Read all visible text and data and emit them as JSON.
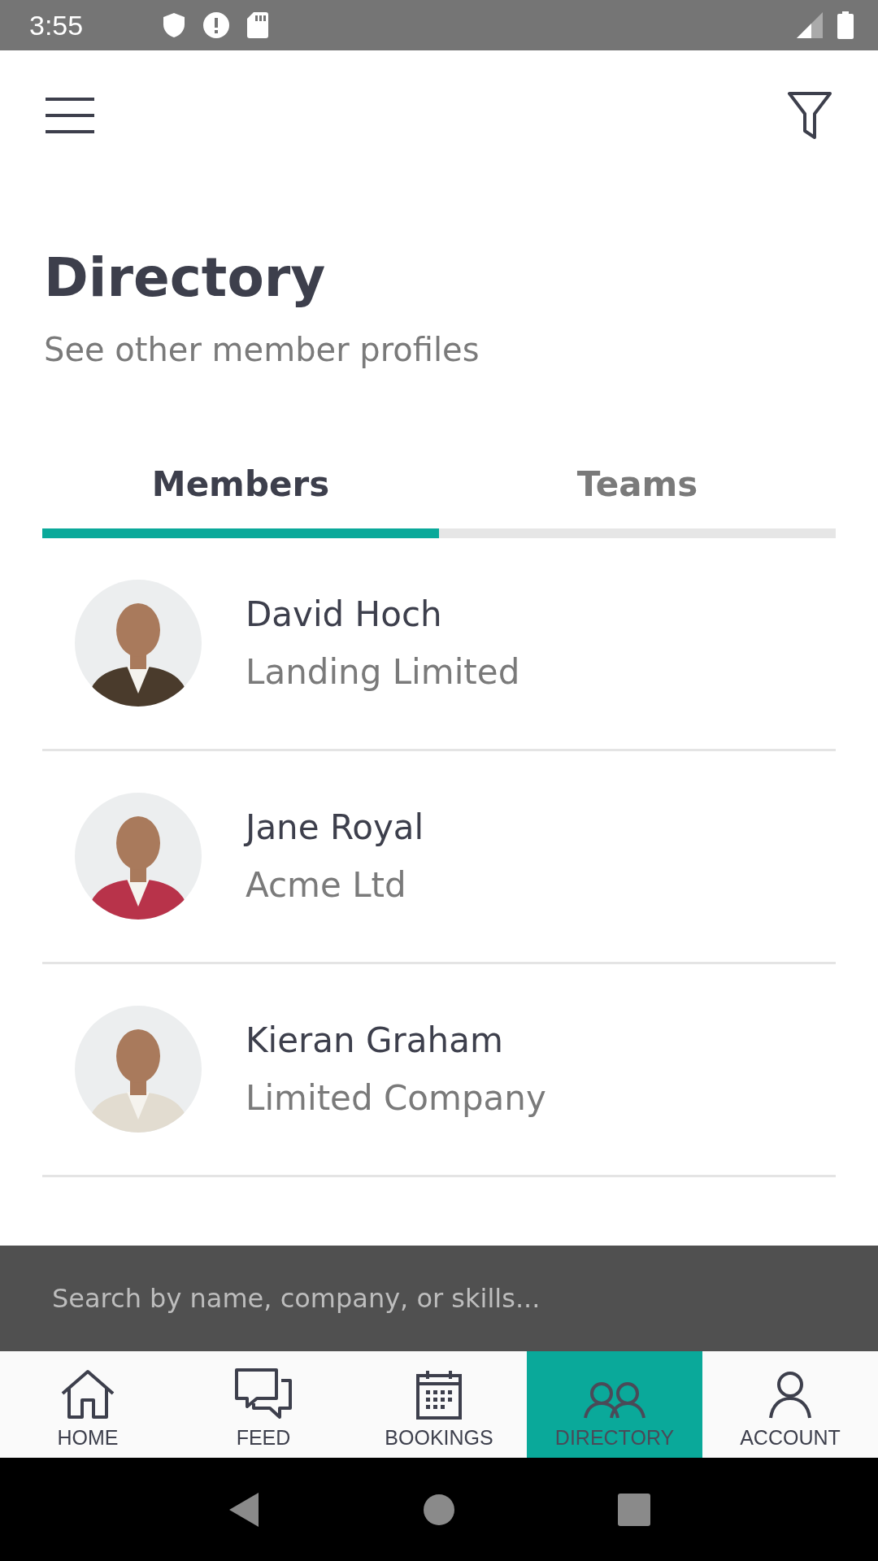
{
  "status_bar": {
    "time": "3:55"
  },
  "header": {
    "title": "Directory",
    "subtitle": "See other member profiles"
  },
  "tabs": [
    {
      "label": "Members",
      "selected": true
    },
    {
      "label": "Teams",
      "selected": false
    }
  ],
  "members": [
    {
      "name": "David Hoch",
      "company": "Landing Limited",
      "kind": "picture"
    },
    {
      "name": "Jane Royal",
      "company": "Acme Ltd",
      "kind": "picture"
    },
    {
      "name": "Kieran Graham",
      "company": "Limited Company",
      "kind": "picture"
    }
  ],
  "search": {
    "placeholder": "Search by name, company, or skills..."
  },
  "nav": [
    {
      "label": "HOME",
      "selected": false
    },
    {
      "label": "FEED",
      "selected": false
    },
    {
      "label": "BOOKINGS",
      "selected": false
    },
    {
      "label": "DIRECTORY",
      "selected": true
    },
    {
      "label": "ACCOUNT",
      "selected": false
    }
  ]
}
